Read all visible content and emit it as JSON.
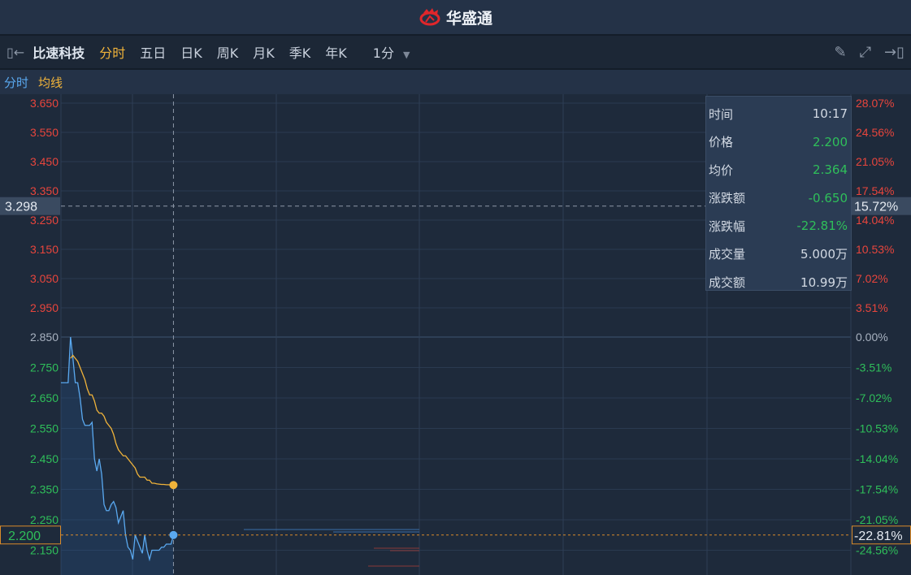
{
  "app": {
    "brand": "华盛通"
  },
  "toolbar": {
    "stock_name": "比速科技",
    "tabs": [
      "分时",
      "五日",
      "日K",
      "周K",
      "月K",
      "季K",
      "年K"
    ],
    "active_tab": "分时",
    "interval": "1分"
  },
  "subbar": {
    "series1": "分时",
    "series2": "均线"
  },
  "tooltip": {
    "rows": [
      {
        "k": "时间",
        "v": "10:17",
        "color": "#d2d9e3"
      },
      {
        "k": "价格",
        "v": "2.200",
        "color": "#2fbf5a"
      },
      {
        "k": "均价",
        "v": "2.364",
        "color": "#2fbf5a"
      },
      {
        "k": "涨跌额",
        "v": "-0.650",
        "color": "#2fbf5a"
      },
      {
        "k": "涨跌幅",
        "v": "-22.81%",
        "color": "#2fbf5a"
      },
      {
        "k": "成交量",
        "v": "5.000万",
        "color": "#d2d9e3"
      },
      {
        "k": "成交额",
        "v": "10.99万",
        "color": "#d2d9e3"
      }
    ]
  },
  "crosshair": {
    "price": "3.298",
    "pct": "15.72%"
  },
  "last": {
    "price": "2.200",
    "pct": "-22.81%"
  },
  "chart_data": {
    "type": "line",
    "prev_close": 2.85,
    "ylim": [
      2.1,
      3.65
    ],
    "left_ticks": [
      "3.650",
      "3.550",
      "3.450",
      "3.350",
      "3.250",
      "3.150",
      "3.050",
      "2.950",
      "2.850",
      "2.750",
      "2.650",
      "2.550",
      "2.450",
      "2.350",
      "2.250",
      "2.150"
    ],
    "right_ticks": [
      "28.07%",
      "24.56%",
      "21.05%",
      "17.54%",
      "14.04%",
      "10.53%",
      "7.02%",
      "3.51%",
      "0.00%",
      "-3.51%",
      "-7.02%",
      "-10.53%",
      "-14.04%",
      "-17.54%",
      "-21.05%",
      "-24.56%"
    ],
    "session_minutes": 330,
    "series": [
      {
        "name": "分时",
        "color": "#5aa9f0",
        "values": [
          2.7,
          2.7,
          2.7,
          2.7,
          2.85,
          2.78,
          2.7,
          2.7,
          2.65,
          2.58,
          2.56,
          2.56,
          2.56,
          2.57,
          2.45,
          2.41,
          2.45,
          2.4,
          2.3,
          2.28,
          2.28,
          2.3,
          2.31,
          2.29,
          2.24,
          2.26,
          2.28,
          2.2,
          2.16,
          2.15,
          2.12,
          2.2,
          2.18,
          2.16,
          2.14,
          2.2,
          2.15,
          2.12,
          2.15,
          2.15,
          2.15,
          2.15,
          2.16,
          2.16,
          2.17,
          2.17,
          2.17,
          2.2
        ]
      },
      {
        "name": "均线",
        "color": "#f0b33a",
        "values": [
          null,
          null,
          null,
          null,
          2.78,
          2.79,
          2.78,
          2.77,
          2.75,
          2.73,
          2.71,
          2.68,
          2.66,
          2.66,
          2.64,
          2.61,
          2.6,
          2.6,
          2.59,
          2.57,
          2.56,
          2.55,
          2.53,
          2.5,
          2.48,
          2.47,
          2.46,
          2.46,
          2.45,
          2.44,
          2.43,
          2.42,
          2.4,
          2.39,
          2.39,
          2.39,
          2.38,
          2.38,
          2.37,
          2.37,
          2.368,
          2.367,
          2.366,
          2.366,
          2.365,
          2.365,
          2.364,
          2.364
        ]
      }
    ]
  }
}
